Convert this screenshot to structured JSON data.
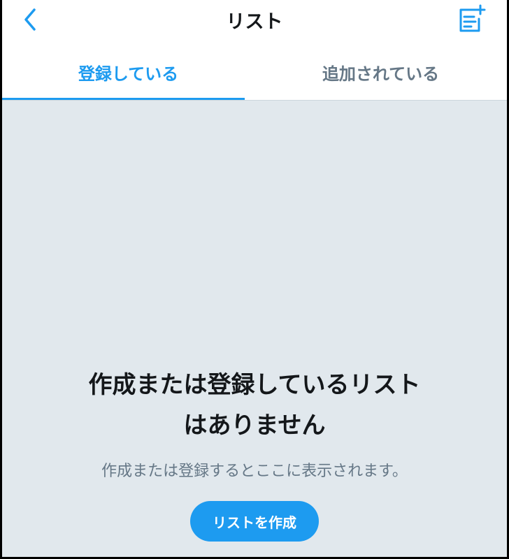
{
  "header": {
    "title": "リスト",
    "back_icon": "chevron-left-icon",
    "new_list_icon": "new-list-icon"
  },
  "tabs": [
    {
      "label": "登録している",
      "active": true
    },
    {
      "label": "追加されている",
      "active": false
    }
  ],
  "empty_state": {
    "title_line1": "作成または登録しているリスト",
    "title_line2": "はありません",
    "subtitle": "作成または登録するとここに表示されます。",
    "button_label": "リストを作成"
  },
  "colors": {
    "accent": "#1d9bf0",
    "background": "#e1e8ed",
    "text_primary": "#14171a",
    "text_secondary": "#657786"
  }
}
